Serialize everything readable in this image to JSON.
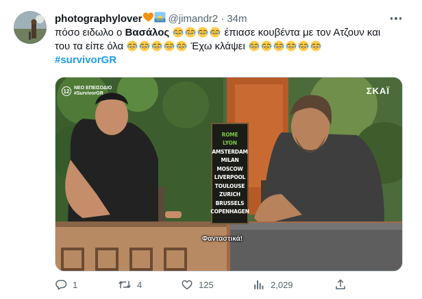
{
  "tweet": {
    "display_name": "photographylover",
    "name_emojis": [
      "orange-heart",
      "sunrise"
    ],
    "handle": "@jimandr2",
    "separator": "·",
    "time": "34m",
    "text": {
      "line1_a": "πόσο ειδωλο ο ",
      "line1_bold": "Βασάλος",
      "line1_b": " έπιασε κουβέντα με τον Ατζουν και",
      "line2_a": "του τα είπε όλα ",
      "line2_b": " Έχω κλάψει ",
      "hashtag": "#survivorGR",
      "emoji_name": "face-with-tears-of-joy"
    },
    "media": {
      "channel_badge": "12",
      "channel_line1": "ΝΕΟ ΕΠΕΙΣΟΔΙΟ",
      "channel_line2": "#SurvivorGR",
      "network": "ΣΚΑΪ",
      "board_cities": [
        "ROME",
        "LYON",
        "AMSTERDAM",
        "MILAN",
        "MOSCOW",
        "LIVERPOOL",
        "TOULOUSE",
        "ZURICH",
        "BRUSSELS",
        "COPENHAGEN"
      ],
      "board_highlighted": [
        "ROME",
        "LYON"
      ],
      "subtitle": "Φανταστικά!"
    },
    "actions": {
      "reply_count": "1",
      "retweet_count": "4",
      "like_count": "125",
      "views_count": "2,029"
    },
    "colors": {
      "accent": "#1d9bf0",
      "secondary_text": "#536471",
      "board_highlight": "#7cc644"
    }
  }
}
